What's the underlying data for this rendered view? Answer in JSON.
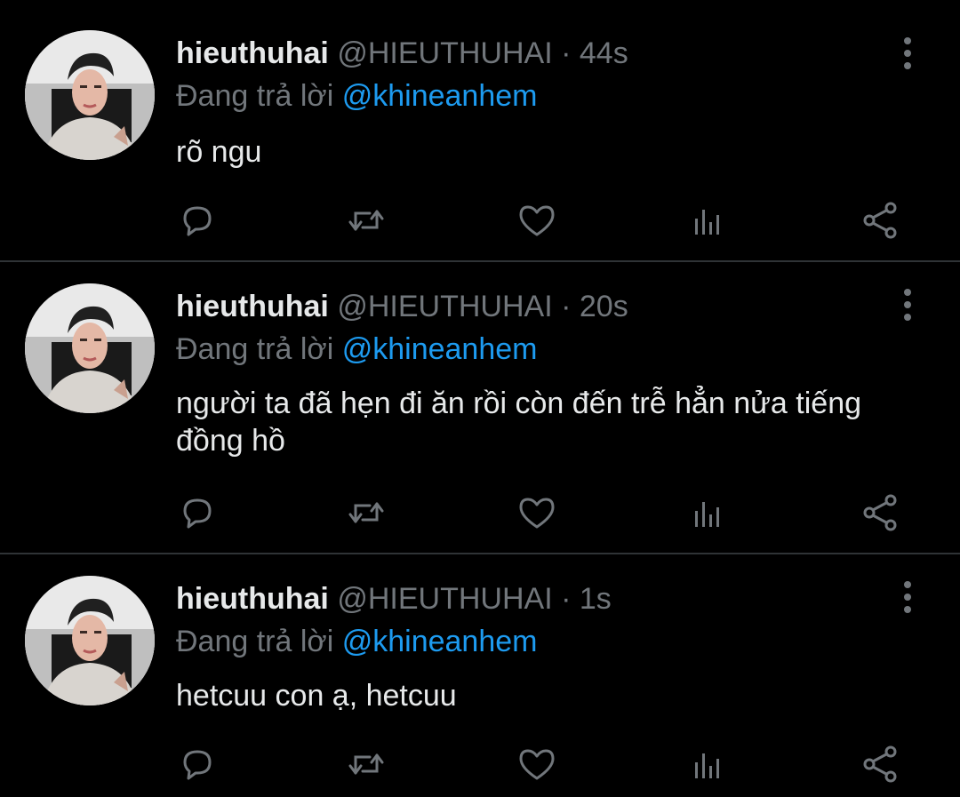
{
  "tweets": [
    {
      "name": "hieuthuhai",
      "handle": "@HIEUTHUHAI",
      "dot": "·",
      "time": "44s",
      "reply_prefix": "Đang trả lời",
      "reply_to": "@khineanhem",
      "text": "rõ ngu"
    },
    {
      "name": "hieuthuhai",
      "handle": "@HIEUTHUHAI",
      "dot": "·",
      "time": "20s",
      "reply_prefix": "Đang trả lời",
      "reply_to": "@khineanhem",
      "text": "người ta đã hẹn đi ăn rồi còn đến trễ hẳn nửa tiếng đồng hồ"
    },
    {
      "name": "hieuthuhai",
      "handle": "@HIEUTHUHAI",
      "dot": "·",
      "time": "1s",
      "reply_prefix": "Đang trả lời",
      "reply_to": "@khineanhem",
      "text": "hetcuu con ạ, hetcuu"
    }
  ],
  "icons": [
    "reply-icon",
    "retweet-icon",
    "like-icon",
    "analytics-icon",
    "share-icon",
    "more-icon"
  ],
  "colors": {
    "background": "#000000",
    "text": "#e7e9ea",
    "muted": "#71767b",
    "accent": "#1d9bf0",
    "divider": "#2f3336"
  }
}
